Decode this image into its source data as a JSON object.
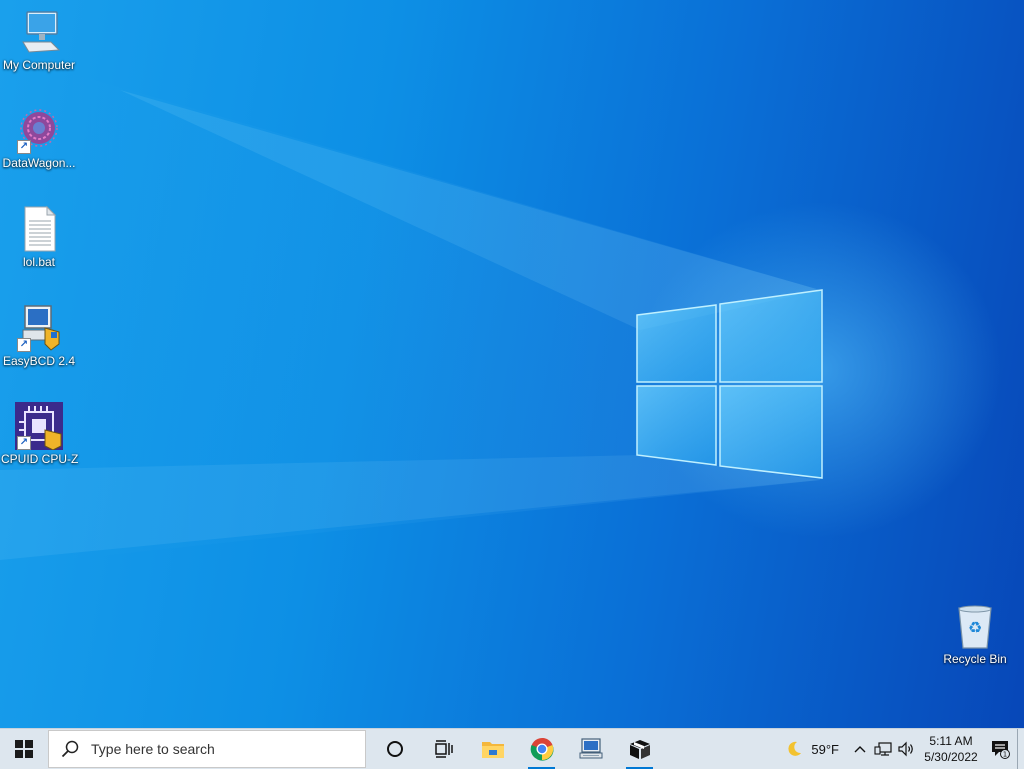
{
  "desktop": {
    "icons": [
      {
        "label": "My Computer",
        "icon": "computer-icon"
      },
      {
        "label": "DataWagon...",
        "icon": "datawagon-icon"
      },
      {
        "label": "lol.bat",
        "icon": "batch-file-icon"
      },
      {
        "label": "EasyBCD 2.4",
        "icon": "easybcd-icon"
      },
      {
        "label": "CPUID CPU-Z",
        "icon": "cpuz-icon"
      }
    ],
    "recycle_bin": {
      "label": "Recycle Bin",
      "icon": "recycle-bin-icon"
    }
  },
  "taskbar": {
    "search_placeholder": "Type here to search",
    "apps": [
      {
        "name": "cortana",
        "icon": "cortana-circle-icon"
      },
      {
        "name": "task-view",
        "icon": "task-view-icon"
      },
      {
        "name": "file-explorer",
        "icon": "folder-icon"
      },
      {
        "name": "chrome",
        "icon": "chrome-icon"
      },
      {
        "name": "network-app",
        "icon": "network-computer-icon"
      },
      {
        "name": "box-app",
        "icon": "package-box-icon"
      }
    ],
    "weather": {
      "temp": "59°F",
      "icon": "moon-icon"
    },
    "clock": {
      "time": "5:11 AM",
      "date": "5/30/2022"
    },
    "notification_count": "1"
  },
  "colors": {
    "desktop_blue": "#0a78d6",
    "taskbar_bg": "#dde6ee",
    "accent": "#0078d4"
  }
}
